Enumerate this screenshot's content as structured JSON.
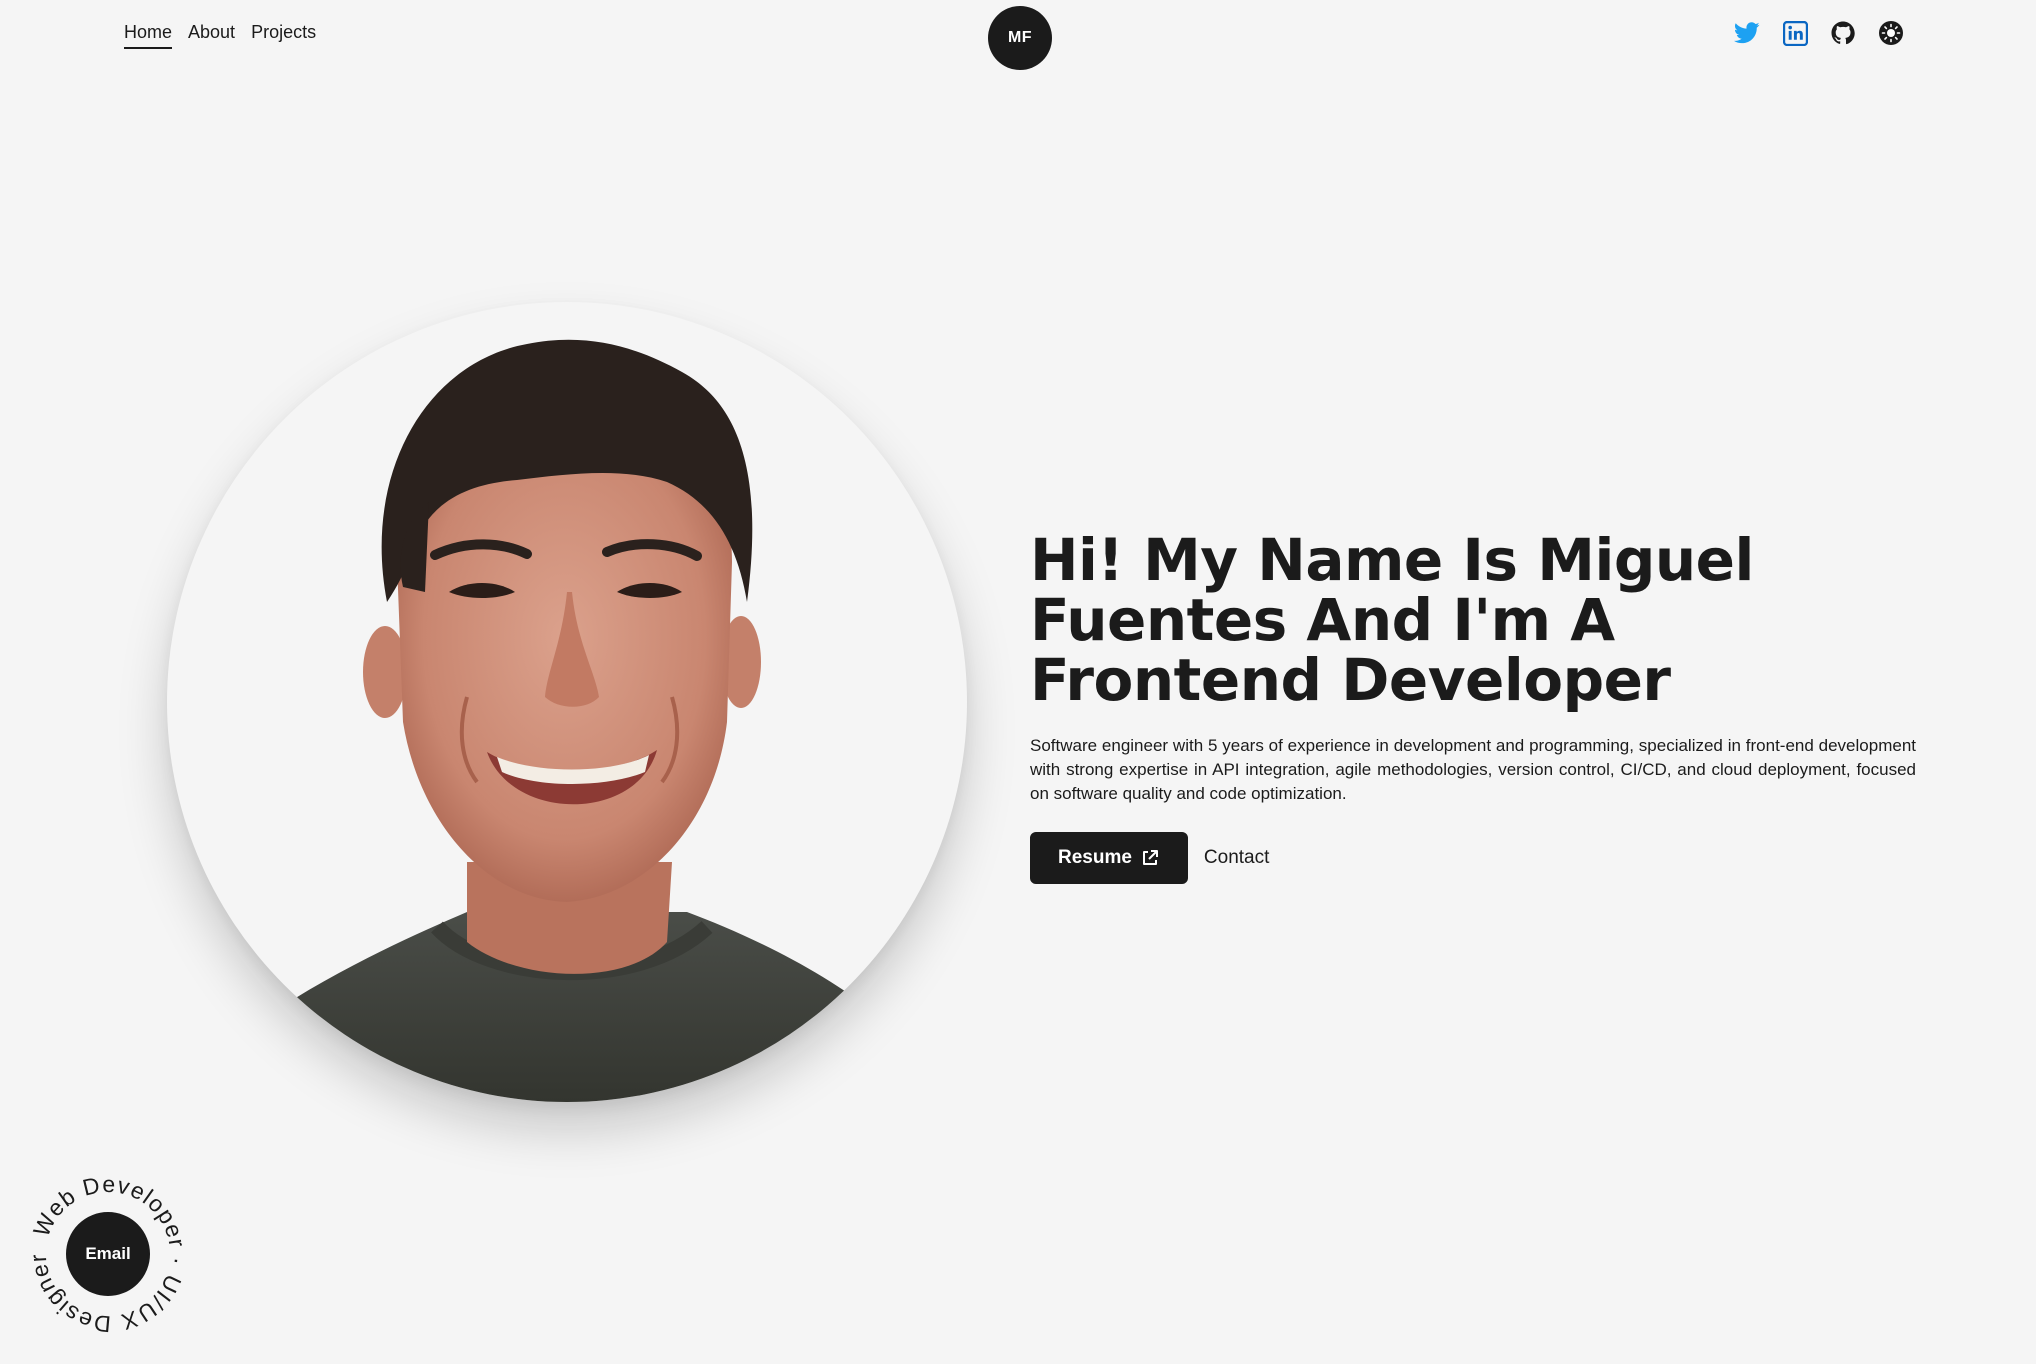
{
  "nav": {
    "items": [
      {
        "label": "Home",
        "active": true
      },
      {
        "label": "About",
        "active": false
      },
      {
        "label": "Projects",
        "active": false
      }
    ]
  },
  "logo": {
    "text": "MF"
  },
  "socials": [
    {
      "name": "twitter-icon",
      "color": "#1da1f2"
    },
    {
      "name": "linkedin-icon",
      "color": "#0a66c2"
    },
    {
      "name": "github-icon",
      "color": "#1b1b1b"
    },
    {
      "name": "theme-toggle-icon",
      "color": "#1b1b1b"
    }
  ],
  "hero": {
    "headline": "Hi! My Name Is Miguel Fuentes And I'm A Frontend Developer",
    "bio": "Software engineer with 5 years of experience in development and programming, specialized in front-end development with strong expertise in API integration, agile methodologies, version control, CI/CD, and cloud deployment, focused on software quality and code optimization.",
    "resume_label": "Resume",
    "contact_label": "Contact"
  },
  "badge": {
    "ring_text": "Web Developer · UI/UX Designer ·",
    "email_label": "Email"
  },
  "colors": {
    "background": "#f5f5f5",
    "dark": "#1b1b1b",
    "twitter": "#1da1f2",
    "linkedin": "#0a66c2"
  }
}
